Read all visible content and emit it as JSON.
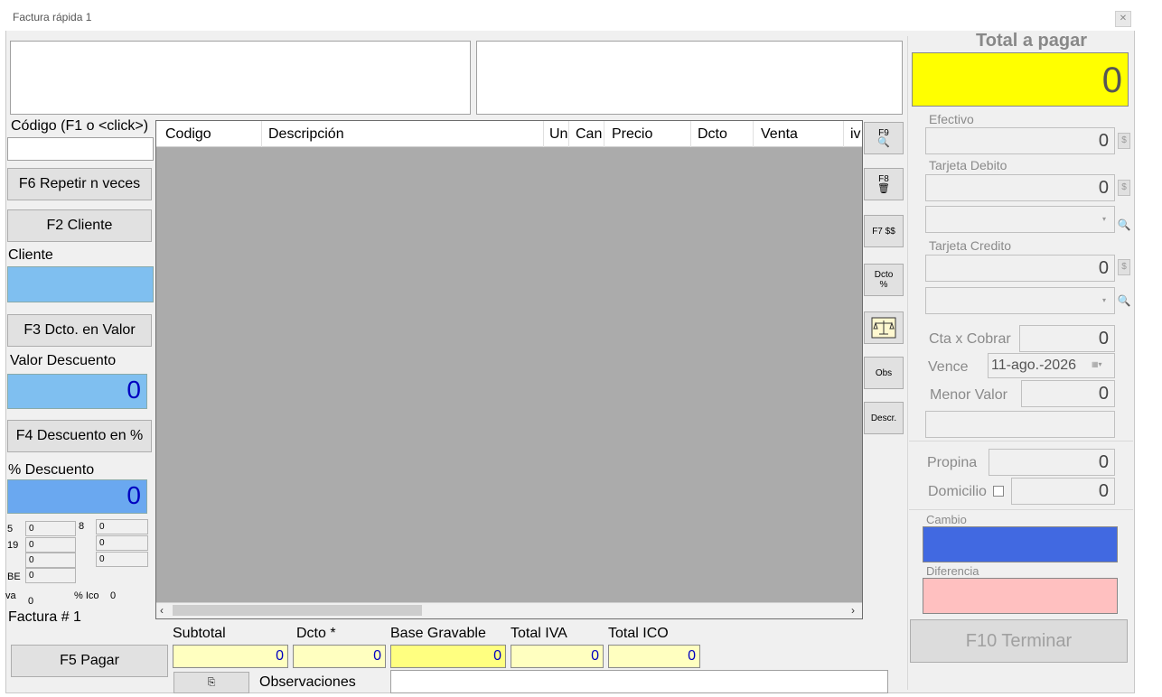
{
  "window": {
    "title": "Factura rápida 1",
    "close_icon": "close-icon"
  },
  "left": {
    "codigo_label": "Código (F1 o <click>)",
    "codigo_value": "",
    "btn_repetir": "F6 Repetir n veces",
    "btn_cliente": "F2 Cliente",
    "cliente_label": "Cliente",
    "cliente_value": "",
    "btn_dcto_valor": "F3 Dcto. en Valor",
    "valor_descuento_label": "Valor Descuento",
    "valor_descuento": "0",
    "btn_descuento_pct": "F4 Descuento en %",
    "pct_descuento_label": "% Descuento",
    "pct_descuento": "0",
    "tax": {
      "r5_label": "5",
      "r5_val": "0",
      "r19_label": "19",
      "r19_val": "0",
      "r3_val": "0",
      "be_label": "BE",
      "be_val": "0",
      "c8_label": "8",
      "c1_val": "0",
      "c2_val": "0",
      "c3_val": "0",
      "iva_label": "va",
      "iva_val": "0",
      "ico_label": "% Ico",
      "ico_val": "0"
    },
    "factura_label": "Factura # 1",
    "btn_pagar": "F5 Pagar"
  },
  "grid": {
    "columns": [
      "Codigo",
      "Descripción",
      "Un",
      "Can",
      "Precio",
      "Dcto",
      "Venta",
      "iva"
    ],
    "rows": []
  },
  "side_buttons": {
    "f9": "F9",
    "f8": "F8",
    "f7": "F7 $$",
    "dcto_top": "Dcto",
    "dcto_bottom": "%",
    "obs": "Obs",
    "descr": "Descr."
  },
  "bottom": {
    "subtotal_label": "Subtotal",
    "subtotal": "0",
    "dcto_label": "Dcto *",
    "dcto": "0",
    "base_label": "Base Gravable",
    "base": "0",
    "iva_label": "Total IVA",
    "iva": "0",
    "ico_label": "Total ICO",
    "ico": "0",
    "observaciones_label": "Observaciones",
    "observaciones": ""
  },
  "right": {
    "total_label": "Total a pagar",
    "total": "0",
    "efectivo_label": "Efectivo",
    "efectivo": "0",
    "debito_label": "Tarjeta Debito",
    "debito": "0",
    "credito_label": "Tarjeta Credito",
    "credito": "0",
    "cxc_label": "Cta x Cobrar",
    "cxc": "0",
    "vence_label": "Vence",
    "vence": "11-ago.-2026",
    "menor_label": "Menor Valor",
    "menor": "0",
    "propina_label": "Propina",
    "propina": "0",
    "domicilio_label": "Domicilio",
    "domicilio": "0",
    "cambio_label": "Cambio",
    "diferencia_label": "Diferencia",
    "btn_terminar": "F10 Terminar",
    "dollar_sign": "$"
  },
  "colors": {
    "total_bg": "#ffff00",
    "cambio_bg": "#4169e1",
    "diferencia_bg": "#ffc0c0",
    "yellow_field": "#ffffc0"
  }
}
